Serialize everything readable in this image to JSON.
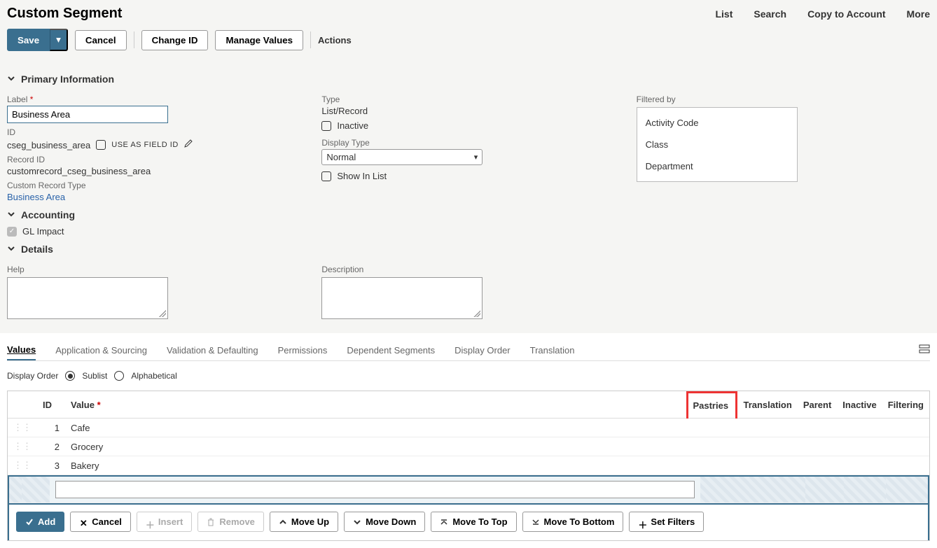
{
  "page": {
    "title": "Custom Segment"
  },
  "top_links": [
    "List",
    "Search",
    "Copy to Account",
    "More"
  ],
  "toolbar": {
    "save": "Save",
    "cancel": "Cancel",
    "change_id": "Change ID",
    "manage_values": "Manage Values",
    "actions": "Actions"
  },
  "sections": {
    "primary": "Primary Information",
    "accounting": "Accounting",
    "details": "Details"
  },
  "primary": {
    "label_lbl": "Label",
    "label_val": "Business Area",
    "id_lbl": "ID",
    "id_val": "cseg_business_area",
    "use_as_field_id": "USE AS FIELD ID",
    "record_id_lbl": "Record ID",
    "record_id_val": "customrecord_cseg_business_area",
    "custom_record_type_lbl": "Custom Record Type",
    "custom_record_type_val": "Business Area",
    "type_lbl": "Type",
    "type_val": "List/Record",
    "inactive_lbl": "Inactive",
    "display_type_lbl": "Display Type",
    "display_type_val": "Normal",
    "show_in_list_lbl": "Show In List",
    "filtered_by_lbl": "Filtered by",
    "filtered_items": [
      "Activity Code",
      "Class",
      "Department"
    ]
  },
  "accounting": {
    "gl_impact": "GL Impact"
  },
  "details": {
    "help_lbl": "Help",
    "description_lbl": "Description"
  },
  "tabs": [
    "Values",
    "Application & Sourcing",
    "Validation & Defaulting",
    "Permissions",
    "Dependent Segments",
    "Display Order",
    "Translation"
  ],
  "display_order": {
    "label": "Display Order",
    "opt1": "Sublist",
    "opt2": "Alphabetical"
  },
  "table": {
    "headers": {
      "id": "ID",
      "value": "Value",
      "pastries": "Pastries",
      "translation": "Translation",
      "parent": "Parent",
      "inactive": "Inactive",
      "filtering": "Filtering"
    },
    "rows": [
      {
        "id": "1",
        "value": "Cafe"
      },
      {
        "id": "2",
        "value": "Grocery"
      },
      {
        "id": "3",
        "value": "Bakery"
      }
    ]
  },
  "sublist_buttons": {
    "add": "Add",
    "cancel": "Cancel",
    "insert": "Insert",
    "remove": "Remove",
    "move_up": "Move Up",
    "move_down": "Move Down",
    "move_to_top": "Move To Top",
    "move_to_bottom": "Move To Bottom",
    "set_filters": "Set Filters"
  }
}
